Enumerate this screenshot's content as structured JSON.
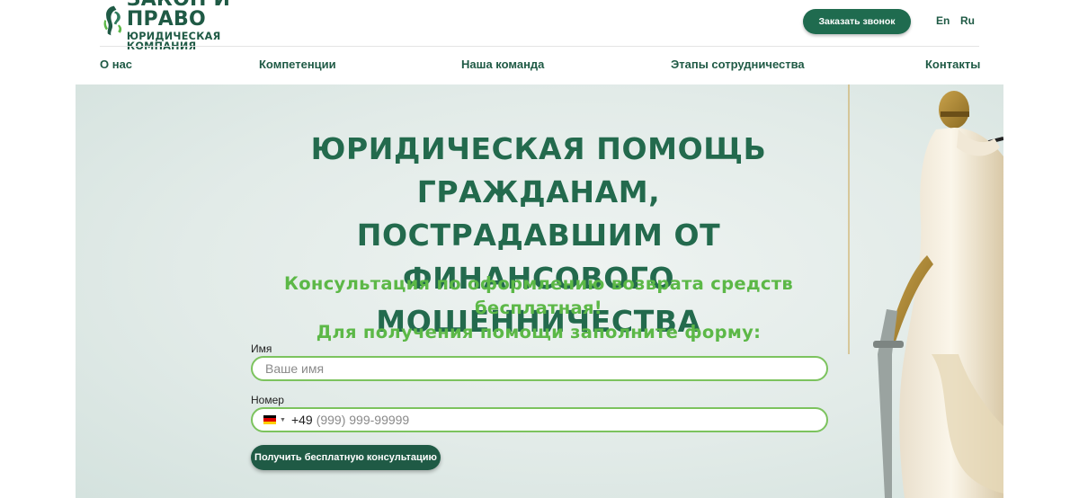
{
  "header": {
    "logo_title": "ЗАКОН И ПРАВО",
    "logo_subtitle": "ЮРИДИЧЕСКАЯ КОМПАНИЯ",
    "call_button": "Заказать звонок",
    "languages": [
      "En",
      "Ru"
    ]
  },
  "nav": {
    "items": [
      {
        "label": "О нас"
      },
      {
        "label": "Компетенции"
      },
      {
        "label": "Наша команда"
      },
      {
        "label": "Этапы сотрудничества"
      },
      {
        "label": "Контакты"
      }
    ]
  },
  "hero": {
    "title_lines": [
      "ЮРИДИЧЕСКАЯ ПОМОЩЬ ГРАЖДАНАМ,",
      "ПОСТРАДАВШИМ ОТ ФИНАНСОВОГО",
      "МОШЕННИЧЕСТВА"
    ],
    "subtitle_lines": [
      "Консультация по оформлению возврата средств бесплатная!",
      "Для получения помощи заполните форму:"
    ]
  },
  "form": {
    "name_label": "Имя",
    "name_placeholder": "Ваше имя",
    "phone_label": "Номер",
    "phone_prefix": "+49",
    "phone_placeholder": "(999) 999-99999",
    "submit_label": "Получить бесплатную консультацию"
  },
  "colors": {
    "brand_dark_green": "#1f5a45",
    "accent_light_green": "#5cb847",
    "field_border": "#7cc35e"
  },
  "icons": [
    "logo-themis-icon",
    "flag-de-icon",
    "caret-down-icon"
  ]
}
